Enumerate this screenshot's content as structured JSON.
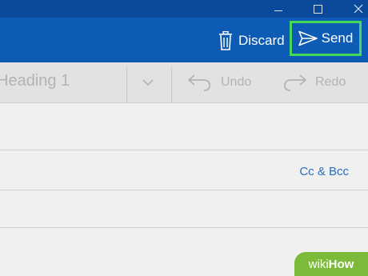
{
  "titlebar": {
    "minimize_icon": "minimize-icon",
    "maximize_icon": "maximize-icon",
    "close_icon": "close-icon"
  },
  "toolbar": {
    "discard_label": "Discard",
    "discard_icon": "trash-icon",
    "send_label": "Send",
    "send_icon": "send-plane-icon",
    "send_highlight_color": "#44d95a"
  },
  "ribbon": {
    "style_value": "Heading 1",
    "dropdown_icon": "chevron-down-icon",
    "undo_label": "Undo",
    "redo_label": "Redo"
  },
  "compose": {
    "cc_bcc_label": "Cc & Bcc"
  },
  "watermark": {
    "wiki": "wiki",
    "how": "How"
  },
  "colors": {
    "titlebar_bg": "#0b4a9a",
    "command_bar_bg": "#0e5bb5",
    "ribbon_bg": "#e2e2e2",
    "compose_bg": "#f0f0f0",
    "link_color": "#2a6db8",
    "watermark_bg": "#7cba3a"
  }
}
